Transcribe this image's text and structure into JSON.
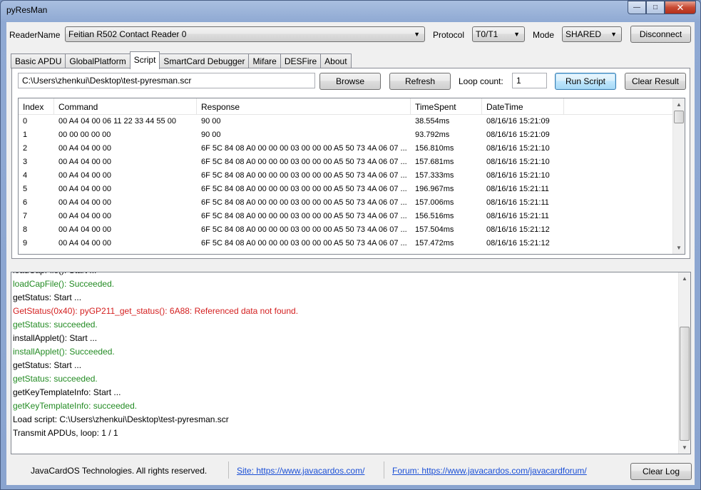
{
  "window": {
    "title": "pyResMan",
    "controls": {
      "minimize": "—",
      "maximize": "□",
      "close": "✕"
    }
  },
  "toolbar": {
    "reader_label": "ReaderName",
    "reader_value": "Feitian R502 Contact Reader 0",
    "protocol_label": "Protocol",
    "protocol_value": "T0/T1",
    "mode_label": "Mode",
    "mode_value": "SHARED",
    "disconnect_label": "Disconnect"
  },
  "tabs": [
    "Basic APDU",
    "GlobalPlatform",
    "Script",
    "SmartCard Debugger",
    "Mifare",
    "DESFire",
    "About"
  ],
  "active_tab": "Script",
  "script": {
    "path_value": "C:\\Users\\zhenkui\\Desktop\\test-pyresman.scr",
    "browse_label": "Browse",
    "refresh_label": "Refresh",
    "loop_label": "Loop count:",
    "loop_value": "1",
    "run_label": "Run Script",
    "clear_result_label": "Clear Result"
  },
  "table": {
    "columns": [
      "Index",
      "Command",
      "Response",
      "TimeSpent",
      "DateTime"
    ],
    "rows": [
      [
        "0",
        "00 A4 04 00 06 11 22 33 44 55 00",
        "90 00",
        "38.554ms",
        "08/16/16 15:21:09"
      ],
      [
        "1",
        "00 00 00 00 00",
        "90 00",
        "93.792ms",
        "08/16/16 15:21:09"
      ],
      [
        "2",
        "00 A4 04 00 00",
        "6F 5C 84 08 A0 00 00 00 03 00 00 00 A5 50 73 4A 06 07 ...",
        "156.810ms",
        "08/16/16 15:21:10"
      ],
      [
        "3",
        "00 A4 04 00 00",
        "6F 5C 84 08 A0 00 00 00 03 00 00 00 A5 50 73 4A 06 07 ...",
        "157.681ms",
        "08/16/16 15:21:10"
      ],
      [
        "4",
        "00 A4 04 00 00",
        "6F 5C 84 08 A0 00 00 00 03 00 00 00 A5 50 73 4A 06 07 ...",
        "157.333ms",
        "08/16/16 15:21:10"
      ],
      [
        "5",
        "00 A4 04 00 00",
        "6F 5C 84 08 A0 00 00 00 03 00 00 00 A5 50 73 4A 06 07 ...",
        "196.967ms",
        "08/16/16 15:21:11"
      ],
      [
        "6",
        "00 A4 04 00 00",
        "6F 5C 84 08 A0 00 00 00 03 00 00 00 A5 50 73 4A 06 07 ...",
        "157.006ms",
        "08/16/16 15:21:11"
      ],
      [
        "7",
        "00 A4 04 00 00",
        "6F 5C 84 08 A0 00 00 00 03 00 00 00 A5 50 73 4A 06 07 ...",
        "156.516ms",
        "08/16/16 15:21:11"
      ],
      [
        "8",
        "00 A4 04 00 00",
        "6F 5C 84 08 A0 00 00 00 03 00 00 00 A5 50 73 4A 06 07 ...",
        "157.504ms",
        "08/16/16 15:21:12"
      ],
      [
        "9",
        "00 A4 04 00 00",
        "6F 5C 84 08 A0 00 00 00 03 00 00 00 A5 50 73 4A 06 07 ...",
        "157.472ms",
        "08/16/16 15:21:12"
      ]
    ]
  },
  "log": {
    "lines": [
      {
        "text": "loadCapFile(): Start ...",
        "color": "black"
      },
      {
        "text": "loadCapFile(): Succeeded.",
        "color": "green"
      },
      {
        "text": "getStatus: Start ...",
        "color": "black"
      },
      {
        "text": "GetStatus(0x40): pyGP211_get_status(): 6A88: Referenced data not found.",
        "color": "red"
      },
      {
        "text": "getStatus: succeeded.",
        "color": "green"
      },
      {
        "text": "installApplet(): Start ...",
        "color": "black"
      },
      {
        "text": "installApplet(): Succeeded.",
        "color": "green"
      },
      {
        "text": "getStatus: Start ...",
        "color": "black"
      },
      {
        "text": "getStatus: succeeded.",
        "color": "green"
      },
      {
        "text": "getKeyTemplateInfo: Start ...",
        "color": "black"
      },
      {
        "text": "getKeyTemplateInfo: succeeded.",
        "color": "green"
      },
      {
        "text": "Load script: C:\\Users\\zhenkui\\Desktop\\test-pyresman.scr",
        "color": "black"
      },
      {
        "text": "Transmit APDUs, loop: 1 / 1",
        "color": "black"
      }
    ]
  },
  "footer": {
    "copyright": "JavaCardOS Technologies. All rights reserved.",
    "site_link": "Site: https://www.javacardos.com/",
    "forum_link": "Forum: https://www.javacardos.com/javacardforum/",
    "clear_log_label": "Clear Log"
  },
  "colors": {
    "log_green": "#238b23",
    "log_red": "#d42020",
    "link_blue": "#1a4fd6"
  },
  "icons": {
    "dropdown": "chevron-down-icon",
    "scroll_up": "scroll-up-arrow-icon",
    "scroll_down": "scroll-down-arrow-icon"
  }
}
